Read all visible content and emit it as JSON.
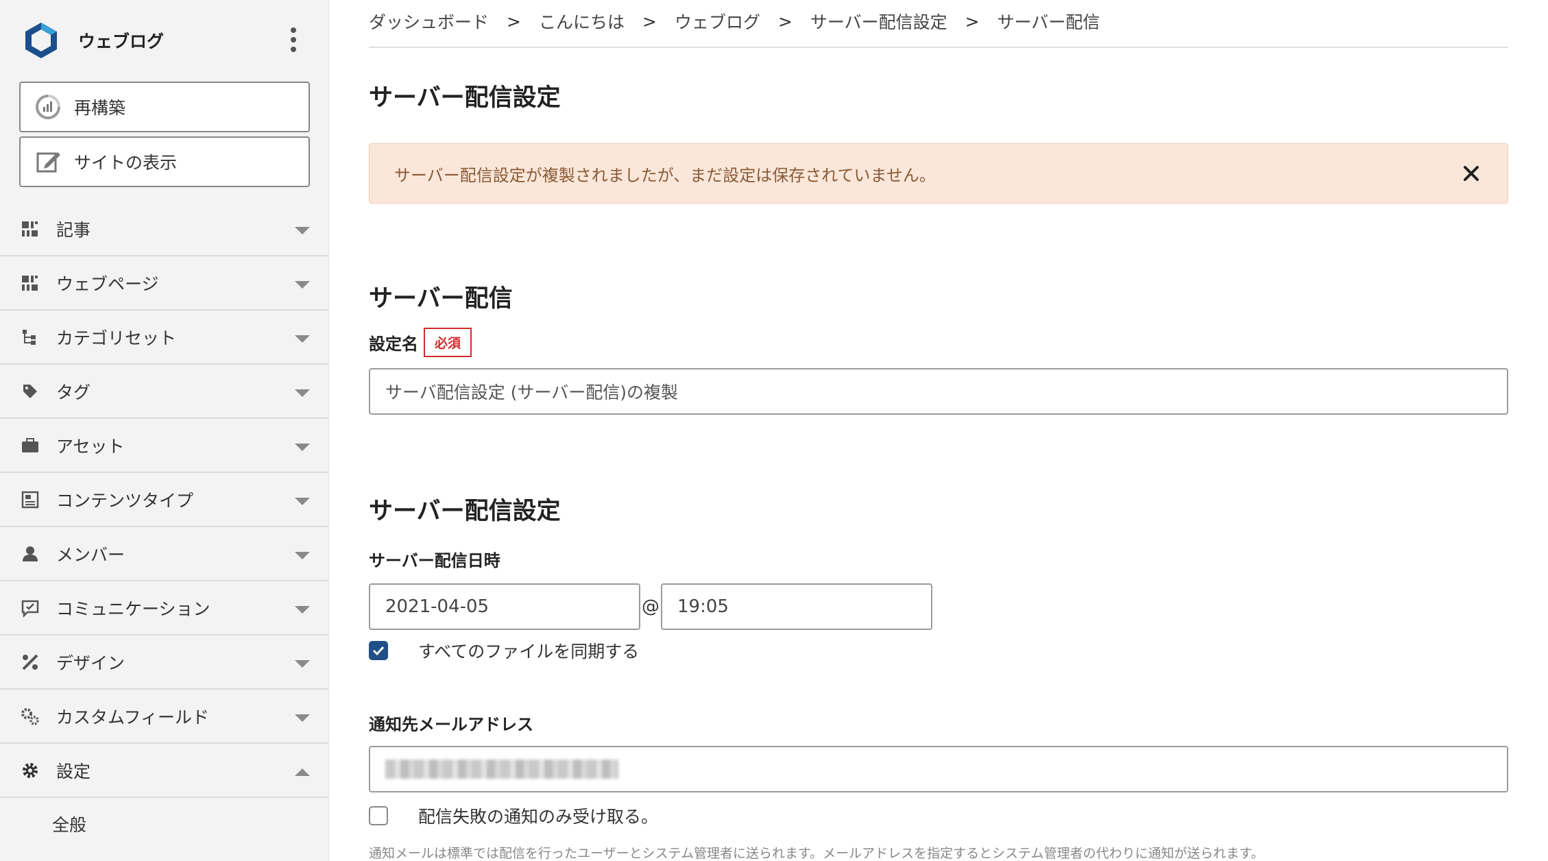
{
  "sidebar": {
    "site_name": "ウェブログ",
    "rebuild_label": "再構築",
    "view_site_label": "サイトの表示",
    "items": [
      {
        "label": "記事"
      },
      {
        "label": "ウェブページ"
      },
      {
        "label": "カテゴリセット"
      },
      {
        "label": "タグ"
      },
      {
        "label": "アセット"
      },
      {
        "label": "コンテンツタイプ"
      },
      {
        "label": "メンバー"
      },
      {
        "label": "コミュニケーション"
      },
      {
        "label": "デザイン"
      },
      {
        "label": "カスタムフィールド"
      },
      {
        "label": "設定"
      }
    ],
    "sub_items": [
      {
        "label": "全般"
      }
    ]
  },
  "breadcrumb": {
    "items": [
      "ダッシュボード",
      "こんにちは",
      "ウェブログ",
      "サーバー配信設定",
      "サーバー配信"
    ],
    "separator": ">"
  },
  "page": {
    "title": "サーバー配信設定",
    "alert": "サーバー配信設定が複製されましたが、まだ設定は保存されていません。"
  },
  "section_delivery": {
    "title": "サーバー配信",
    "name_label": "設定名",
    "required_badge": "必須",
    "name_value": "サーバ配信設定 (サーバー配信)の複製"
  },
  "section_settings": {
    "title": "サーバー配信設定",
    "datetime_label": "サーバー配信日時",
    "date_value": "2021-04-05",
    "at_symbol": "@",
    "time_value": "19:05",
    "sync_all_label": "すべてのファイルを同期する",
    "sync_all_checked": true,
    "email_label": "通知先メールアドレス",
    "failure_only_label": "配信失敗の通知のみ受け取る。",
    "failure_only_checked": false,
    "hint": "通知メールは標準では配信を行ったユーザーとシステム管理者に送られます。メールアドレスを指定するとシステム管理者の代わりに通知が送られます。"
  },
  "colors": {
    "accent": "#1f4f86",
    "required": "#d12c2c",
    "alert_bg": "#fbe7da",
    "sidebar_bg": "#f3f3f3"
  }
}
